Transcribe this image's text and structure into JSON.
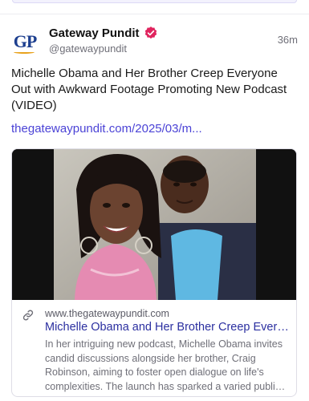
{
  "post": {
    "author": {
      "name": "Gateway Pundit",
      "handle": "@gatewaypundit",
      "avatar_text": "GP",
      "verified_color": "#e0245e"
    },
    "timestamp": "36m",
    "text": "Michelle Obama and Her Brother Creep Everyone Out with Awkward Footage Promoting New Podcast (VIDEO)",
    "link_text": "thegatewaypundit.com/2025/03/m...",
    "link_color": "#4b43d6"
  },
  "card": {
    "domain": "www.thegatewaypundit.com",
    "title": "Michelle Obama and Her Brother Creep Everyone Out with Awkward Footage Promoting New Podcast (VIDEO)",
    "description_lines": [
      "In her intriguing new podcast, Michelle Obama invites",
      "candid discussions alongside her brother, Craig",
      "Robinson, aiming to foster open dialogue on life's",
      "complexities. The launch has sparked a varied public reaction"
    ]
  }
}
